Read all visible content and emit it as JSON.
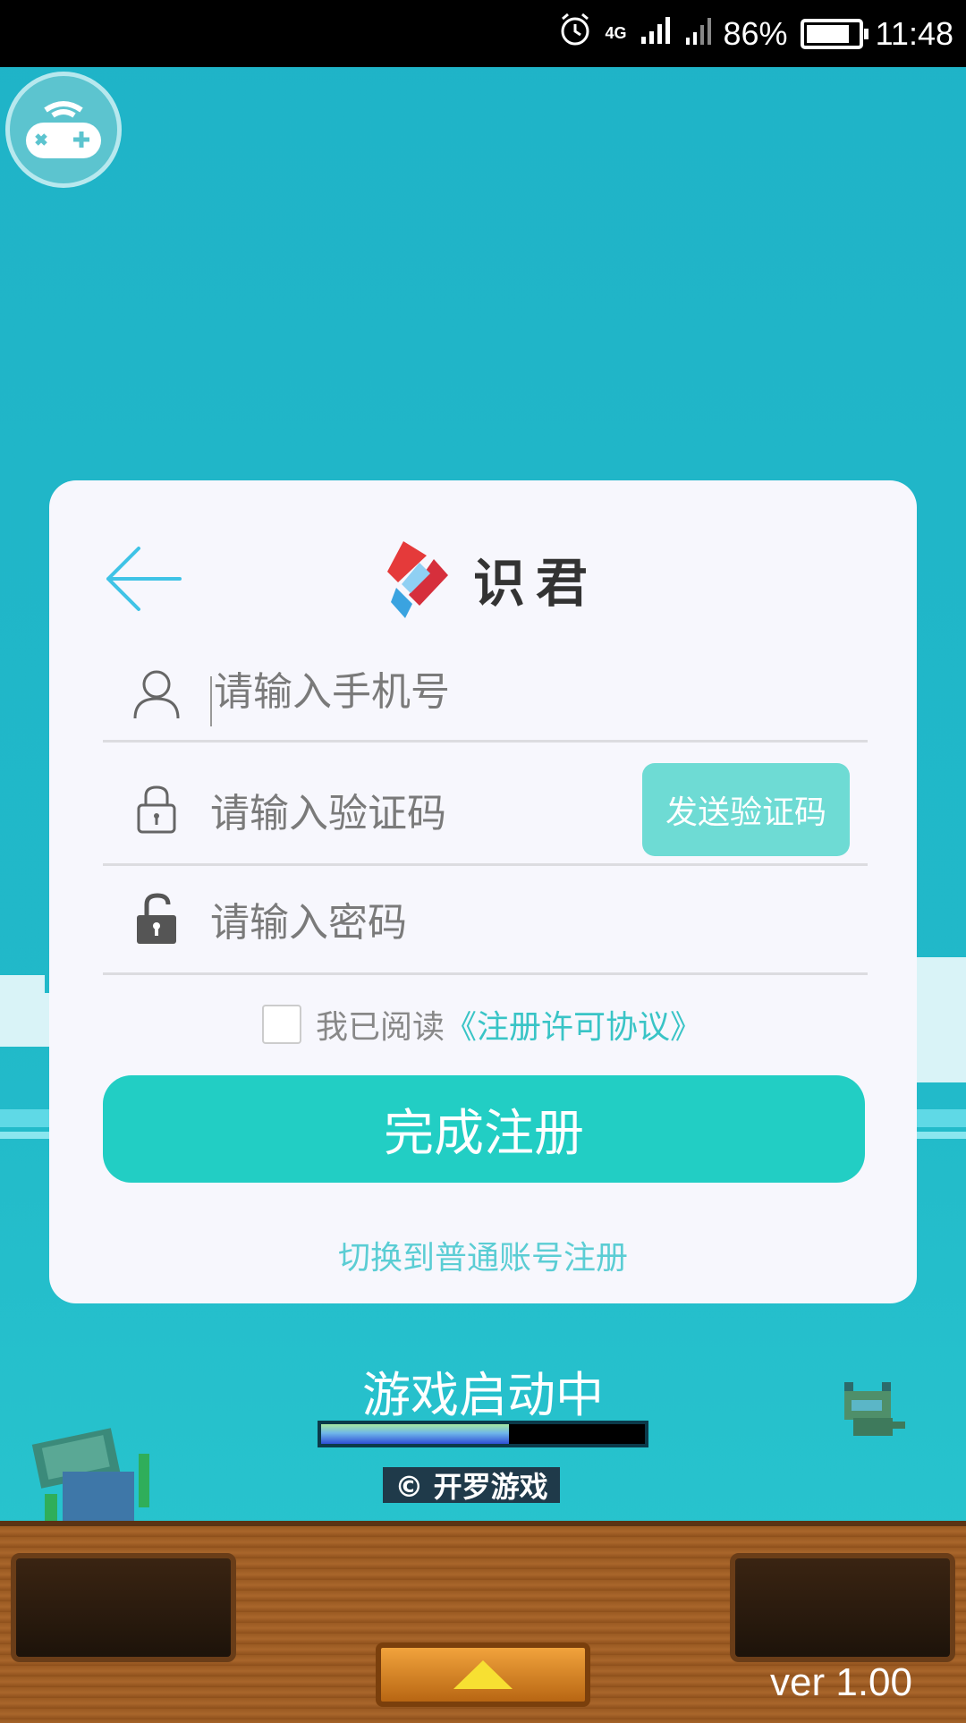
{
  "status_bar": {
    "signal_label": "4G",
    "battery_percent": "86%",
    "battery_level": 0.86,
    "time": "11:48"
  },
  "register_form": {
    "brand_name": "识君",
    "phone_placeholder": "请输入手机号",
    "code_placeholder": "请输入验证码",
    "send_code_label": "发送验证码",
    "password_placeholder": "请输入密码",
    "agree_prefix": "我已阅读",
    "agree_link": "《注册许可协议》",
    "submit_label": "完成注册",
    "switch_label": "切换到普通账号注册"
  },
  "loading": {
    "text": "游戏启动中",
    "progress": 0.58,
    "copyright": "© 开罗游戏"
  },
  "footer": {
    "version": "ver 1.00"
  },
  "colors": {
    "accent": "#22cec4",
    "link": "#39c4c6",
    "send_button": "#6edbd4",
    "back_arrow": "#3fc3e6"
  }
}
